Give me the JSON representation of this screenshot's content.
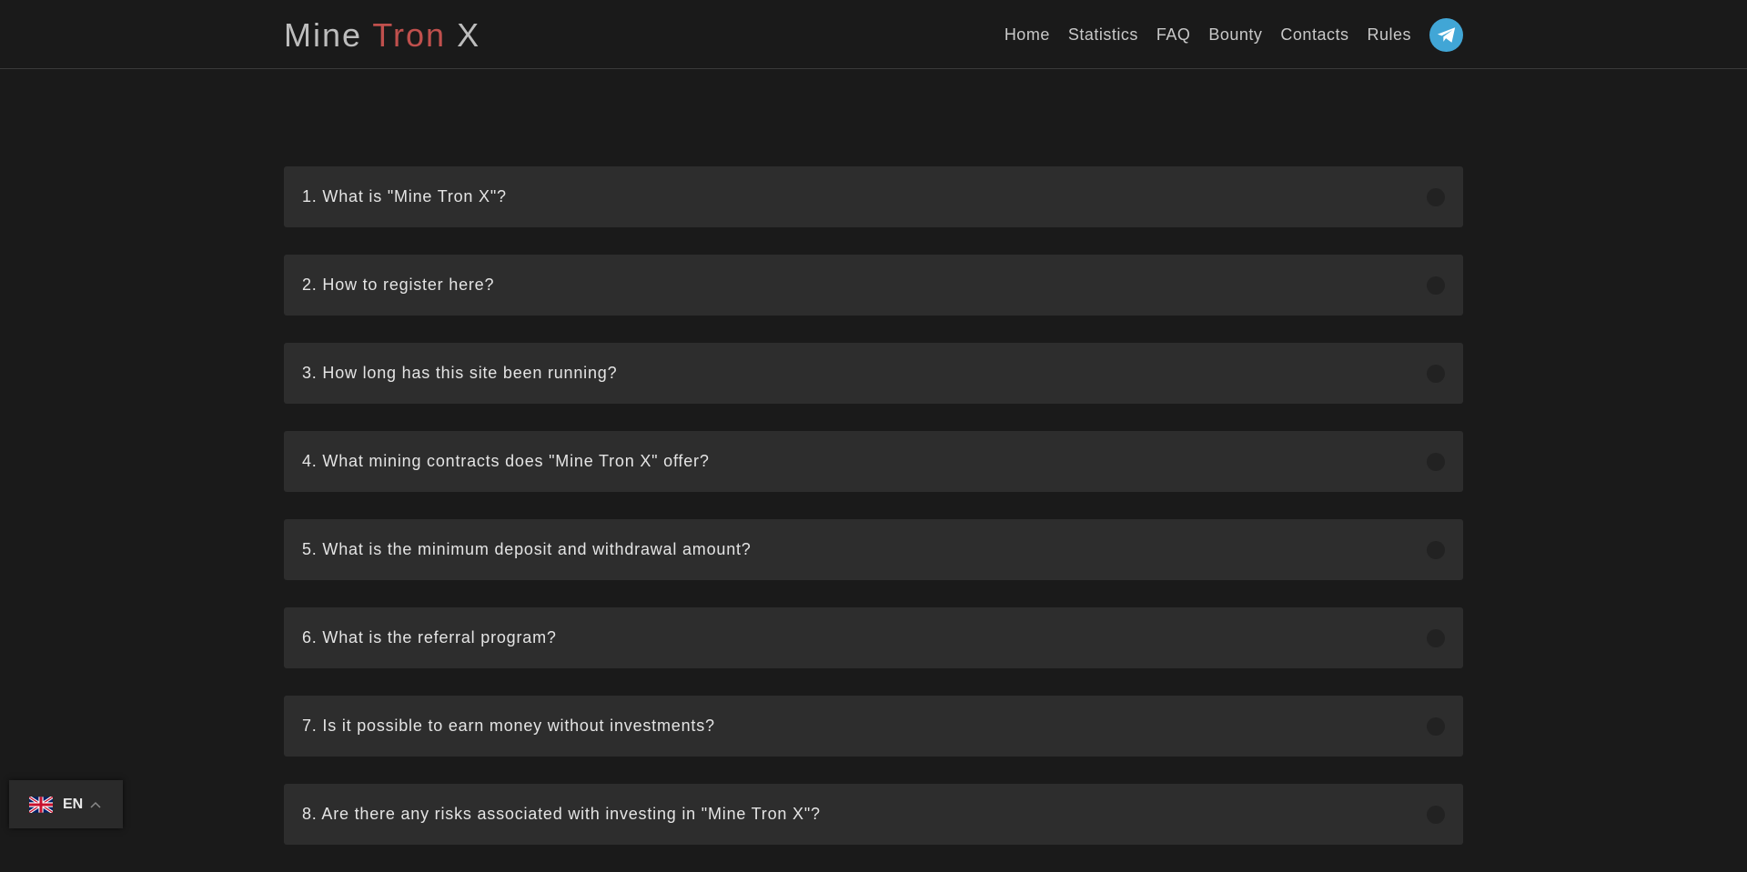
{
  "brand": {
    "part1": "Mine ",
    "part2": "Tron",
    "part3": " X",
    "accent_color": "#c0504d"
  },
  "nav": {
    "items": [
      "Home",
      "Statistics",
      "FAQ",
      "Bounty",
      "Contacts",
      "Rules"
    ],
    "telegram_icon": "telegram-icon"
  },
  "faq": [
    "1. What is \"Mine Tron X\"?",
    "2. How to register here?",
    "3. How long has this site been running?",
    "4. What mining contracts does \"Mine Tron X\" offer?",
    "5. What is the minimum deposit and withdrawal amount?",
    "6. What is the referral program?",
    "7. Is it possible to earn money without investments?",
    "8. Are there any risks associated with investing in \"Mine Tron X\"?"
  ],
  "language": {
    "code": "EN",
    "flag_icon": "uk-flag-icon",
    "chevron_icon": "chevron-up-icon"
  }
}
